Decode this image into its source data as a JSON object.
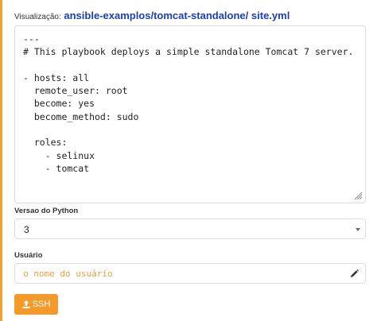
{
  "breadcrumb": {
    "label": "Visualização:",
    "repo": "ansible-examplos/tomcat-standalone/",
    "file": "site.yml"
  },
  "editor": {
    "content": "---\n# This playbook deploys a simple standalone Tomcat 7 server.\n\n- hosts: all\n  remote_user: root\n  become: yes\n  become_method: sudo\n\n  roles:\n    - selinux\n    - tomcat"
  },
  "python_version": {
    "label": "Versao do Python",
    "selected": "3"
  },
  "user": {
    "label": "Usuário",
    "value": "",
    "placeholder": "o nome do usuário"
  },
  "ssh_button": {
    "label": "SSH"
  },
  "colors": {
    "accent": "#f39a2a",
    "link": "#1a3fb8"
  },
  "icons": {
    "resize": "resize-grip-icon",
    "caret": "chevron-down-icon",
    "edit": "pencil-icon",
    "ssh": "upload-user-icon"
  }
}
